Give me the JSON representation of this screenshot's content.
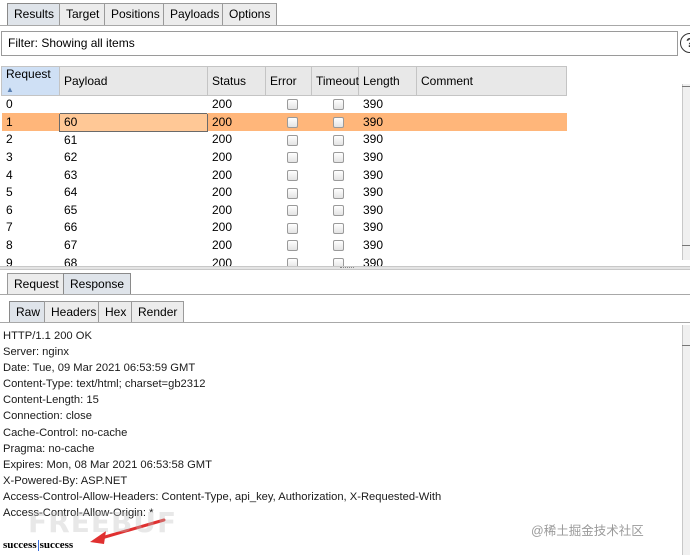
{
  "top_tabs": [
    {
      "label": "Results",
      "active": true
    },
    {
      "label": "Target",
      "active": false
    },
    {
      "label": "Positions",
      "active": false
    },
    {
      "label": "Payloads",
      "active": false
    },
    {
      "label": "Options",
      "active": false
    }
  ],
  "filter": {
    "text": "Filter: Showing all items",
    "help_glyph": "?"
  },
  "results": {
    "columns": [
      "Request",
      "Payload",
      "Status",
      "Error",
      "Timeout",
      "Length",
      "Comment"
    ],
    "sort_glyph": "▲",
    "rows": [
      {
        "request": "0",
        "payload": "",
        "status": "200",
        "length": "390",
        "comment": ""
      },
      {
        "request": "1",
        "payload": "60",
        "status": "200",
        "length": "390",
        "comment": ""
      },
      {
        "request": "2",
        "payload": "61",
        "status": "200",
        "length": "390",
        "comment": ""
      },
      {
        "request": "3",
        "payload": "62",
        "status": "200",
        "length": "390",
        "comment": ""
      },
      {
        "request": "4",
        "payload": "63",
        "status": "200",
        "length": "390",
        "comment": ""
      },
      {
        "request": "5",
        "payload": "64",
        "status": "200",
        "length": "390",
        "comment": ""
      },
      {
        "request": "6",
        "payload": "65",
        "status": "200",
        "length": "390",
        "comment": ""
      },
      {
        "request": "7",
        "payload": "66",
        "status": "200",
        "length": "390",
        "comment": ""
      },
      {
        "request": "8",
        "payload": "67",
        "status": "200",
        "length": "390",
        "comment": ""
      },
      {
        "request": "9",
        "payload": "68",
        "status": "200",
        "length": "390",
        "comment": ""
      }
    ],
    "selected_request": "1"
  },
  "mid_tabs": [
    {
      "label": "Request",
      "active": false
    },
    {
      "label": "Response",
      "active": true
    }
  ],
  "view_tabs": [
    {
      "label": "Raw",
      "active": true
    },
    {
      "label": "Headers",
      "active": false
    },
    {
      "label": "Hex",
      "active": false
    },
    {
      "label": "Render",
      "active": false
    }
  ],
  "response": {
    "lines": [
      "HTTP/1.1 200 OK",
      "Server: nginx",
      "Date: Tue, 09 Mar 2021 06:53:59 GMT",
      "Content-Type: text/html; charset=gb2312",
      "Content-Length: 15",
      "Connection: close",
      "Cache-Control: no-cache",
      "Pragma: no-cache",
      "Expires: Mon, 08 Mar 2021 06:53:58 GMT",
      "X-Powered-By: ASP.NET",
      "Access-Control-Allow-Headers: Content-Type, api_key, Authorization, X-Requested-With",
      "Access-Control-Allow-Origin: *",
      ""
    ],
    "body_left": "success",
    "body_right": "success"
  },
  "watermarks": {
    "freebuf": "FREEBUF",
    "juejin": "@稀土掘金技术社区"
  },
  "colors": {
    "selected_row": "#ffb67a",
    "active_tab": "#dfe4ea",
    "arrow": "#e03030"
  }
}
